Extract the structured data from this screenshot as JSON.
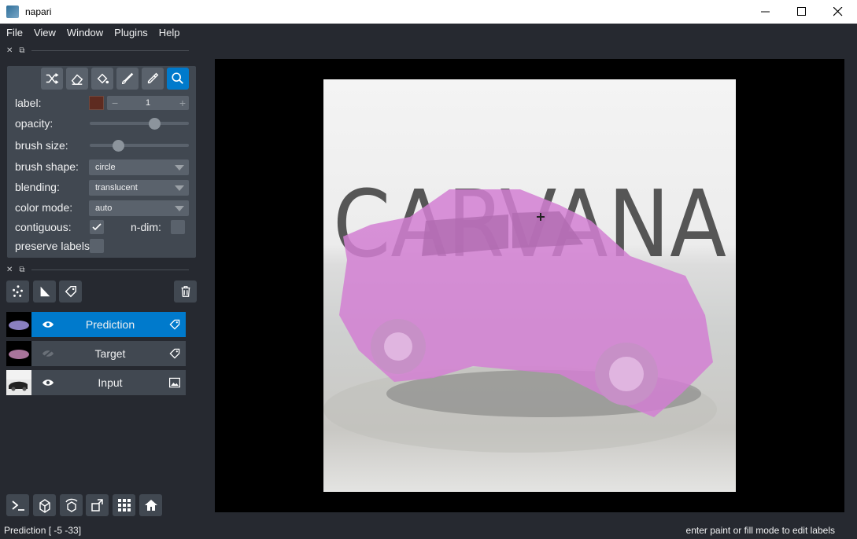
{
  "window": {
    "title": "napari"
  },
  "menu": {
    "items": [
      "File",
      "View",
      "Window",
      "Plugins",
      "Help"
    ]
  },
  "controls": {
    "label_label": "label:",
    "label_value": "1",
    "label_color": "#5e2b20",
    "opacity_label": "opacity:",
    "opacity_value": 0.68,
    "brush_size_label": "brush size:",
    "brush_size_value": 0.26,
    "brush_shape_label": "brush shape:",
    "brush_shape_value": "circle",
    "blending_label": "blending:",
    "blending_value": "translucent",
    "color_mode_label": "color mode:",
    "color_mode_value": "auto",
    "contiguous_label": "contiguous:",
    "contiguous_checked": true,
    "ndim_label": "n-dim:",
    "ndim_checked": false,
    "preserve_labels_label": "preserve labels",
    "preserve_labels_checked": false,
    "active_tool": "pan-zoom"
  },
  "layers": [
    {
      "name": "Prediction",
      "visible": true,
      "selected": true,
      "type": "labels"
    },
    {
      "name": "Target",
      "visible": false,
      "selected": false,
      "type": "labels"
    },
    {
      "name": "Input",
      "visible": true,
      "selected": false,
      "type": "image"
    }
  ],
  "canvas": {
    "image_text": "CARVANA",
    "mask_color": "#d27fd2"
  },
  "status": {
    "left": "Prediction [ -5 -33]",
    "right": "enter paint or fill mode to edit labels"
  },
  "colors": {
    "accent": "#007acc",
    "panel": "#414851",
    "background": "#262930"
  }
}
